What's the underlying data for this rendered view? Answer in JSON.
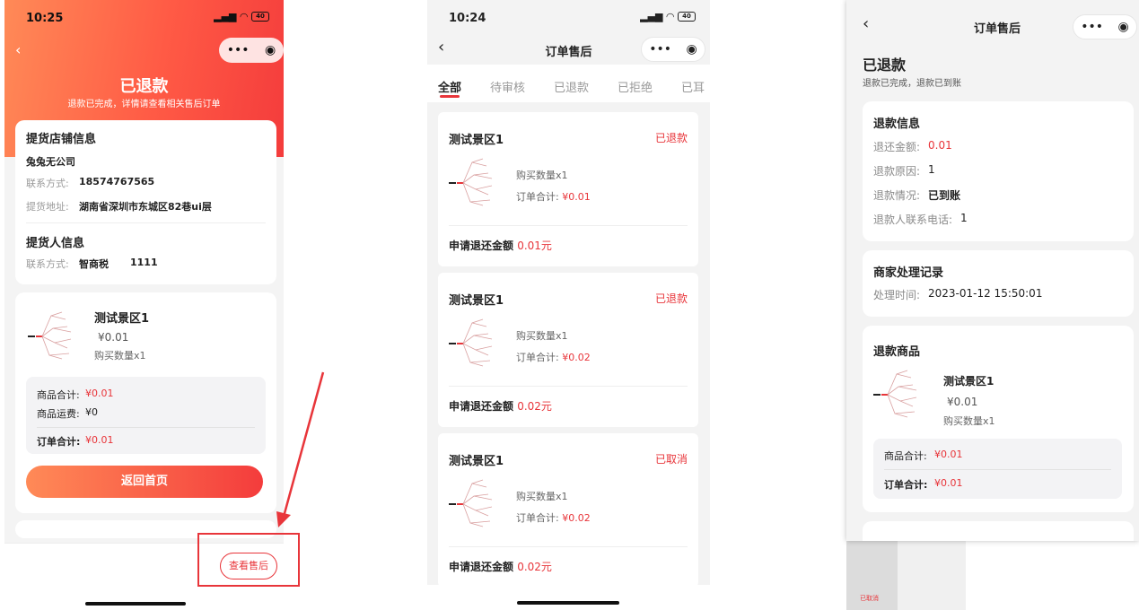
{
  "colors": {
    "accent": "#e8353a",
    "hero_start": "#ff8a57",
    "hero_end": "#f43c3c"
  },
  "panel1": {
    "time": "10:25",
    "title": "已退款",
    "subtitle": "退款已完成，详情请查看相关售后订单",
    "store_card": {
      "heading": "提货店铺信息",
      "store_name": "兔兔无公司",
      "contact_label": "联系方式:",
      "contact_value": "18574767565",
      "address_label": "提货地址:",
      "address_value": "湖南省深圳市东城区82巷ui层",
      "picker_heading": "提货人信息",
      "picker_label": "联系方式:",
      "picker_name": "智商税",
      "picker_phone": "1111"
    },
    "product": {
      "name": "测试景区1",
      "price": "¥0.01",
      "qty": "购买数量x1"
    },
    "summary": {
      "goods_total_label": "商品合计:",
      "goods_total_value": "¥0.01",
      "shipping_label": "商品运费:",
      "shipping_value": "¥0",
      "order_total_label": "订单合计:",
      "order_total_value": "¥0.01"
    },
    "home_button": "返回首页",
    "after_sale_button": "查看售后"
  },
  "panel2": {
    "time": "10:24",
    "title": "订单售后",
    "tabs": [
      "全部",
      "待审核",
      "已退款",
      "已拒绝",
      "已耳"
    ],
    "orders": [
      {
        "shop": "测试景区1",
        "status": "已退款",
        "qty": "购买数量x1",
        "total_label": "订单合计:",
        "total": "¥0.01",
        "refund_label": "申请退还金额",
        "refund": "0.01元"
      },
      {
        "shop": "测试景区1",
        "status": "已退款",
        "qty": "购买数量x1",
        "total_label": "订单合计:",
        "total": "¥0.02",
        "refund_label": "申请退还金额",
        "refund": "0.02元"
      },
      {
        "shop": "测试景区1",
        "status": "已取消",
        "qty": "购买数量x1",
        "total_label": "订单合计:",
        "total": "¥0.02",
        "refund_label": "申请退还金额",
        "refund": "0.02元"
      }
    ]
  },
  "panel3": {
    "title": "订单售后",
    "status": "已退款",
    "status_desc": "退款已完成，退款已到账",
    "refund_info": {
      "heading": "退款信息",
      "amount_label": "退还金额:",
      "amount_value": "0.01",
      "reason_label": "退款原因:",
      "reason_value": "1",
      "state_label": "退款情况:",
      "state_value": "已到账",
      "phone_label": "退款人联系电话:",
      "phone_value": "1"
    },
    "merchant": {
      "heading": "商家处理记录",
      "time_label": "处理时间:",
      "time_value": "2023-01-12 15:50:01"
    },
    "refund_goods": {
      "heading": "退款商品",
      "name": "测试景区1",
      "price": "¥0.01",
      "qty": "购买数量x1",
      "goods_total_label": "商品合计:",
      "goods_total_value": "¥0.01",
      "order_total_label": "订单合计:",
      "order_total_value": "¥0.01"
    },
    "footer_text": "已取消"
  }
}
